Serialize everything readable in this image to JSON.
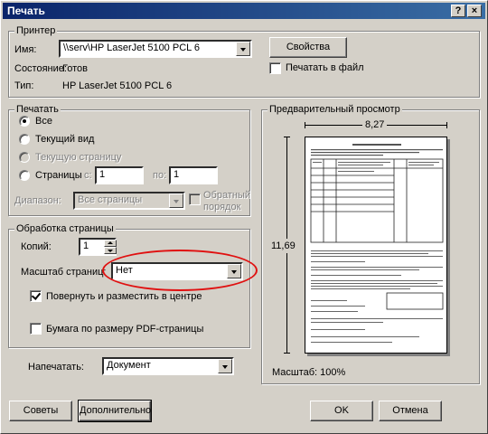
{
  "window": {
    "title": "Печать",
    "help_glyph": "?",
    "close_glyph": "×"
  },
  "printer": {
    "group_title": "Принтер",
    "name_label": "Имя:",
    "name_value": "\\\\serv\\HP LaserJet 5100 PCL 6",
    "properties_button": "Свойства",
    "status_label": "Состояние:",
    "status_value": "Готов",
    "type_label": "Тип:",
    "type_value": "HP LaserJet 5100 PCL 6",
    "print_to_file_label": "Печатать в файл",
    "print_to_file_checked": false
  },
  "print_range": {
    "group_title": "Печатать",
    "all_label": "Все",
    "current_view_label": "Текущий вид",
    "current_page_label": "Текущую страницу",
    "pages_label": "Страницы",
    "from_label": "с:",
    "from_value": "1",
    "to_label": "по:",
    "to_value": "1",
    "selected": "all",
    "range_label": "Диапазон:",
    "range_value": "Все страницы",
    "reverse_label_line1": "Обратный",
    "reverse_label_line2": "порядок",
    "reverse_checked": false
  },
  "page_handling": {
    "group_title": "Обработка страницы",
    "copies_label": "Копий:",
    "copies_value": "1",
    "scale_label": "Масштаб страниц:",
    "scale_value": "Нет",
    "autorotate_label": "Повернуть и разместить в центре",
    "autorotate_checked": true,
    "pdf_paper_label": "Бумага по размеру PDF-страницы",
    "pdf_paper_checked": false
  },
  "print_what": {
    "label": "Напечатать:",
    "value": "Документ"
  },
  "preview": {
    "group_title": "Предварительный просмотр",
    "width_value": "8,27",
    "height_value": "11,69",
    "scale_text": "Масштаб: 100%"
  },
  "buttons": {
    "tips": "Советы",
    "advanced": "Дополнительно",
    "ok": "OK",
    "cancel": "Отмена"
  },
  "colors": {
    "face": "#d4d0c8",
    "title_start": "#0a246a",
    "title_end": "#3a6ea5",
    "annotation": "#e01010"
  }
}
